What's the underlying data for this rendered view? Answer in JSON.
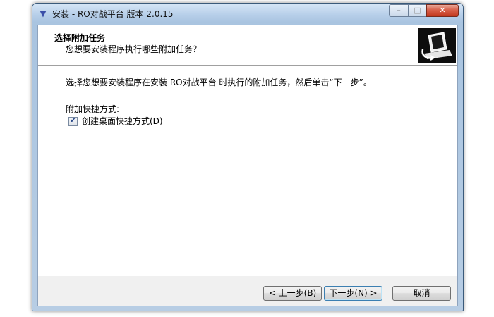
{
  "window": {
    "title": "安装 - RO对战平台 版本 2.0.15",
    "title_icon": "chevron-down-icon",
    "min_glyph": "–",
    "max_glyph": "□",
    "close_glyph": "✕"
  },
  "header": {
    "title": "选择附加任务",
    "description": "您想要安装程序执行哪些附加任务？"
  },
  "body": {
    "instruction": "选择您想要安装程序在安装 RO对战平台 时执行的附加任务，然后单击“下一步”。",
    "group_label": "附加快捷方式:",
    "tasks": [
      {
        "label": "创建桌面快捷方式(D)",
        "checked": true
      }
    ]
  },
  "buttons": {
    "back": "< 上一步(B)",
    "next": "下一步(N) >",
    "cancel": "取消"
  }
}
